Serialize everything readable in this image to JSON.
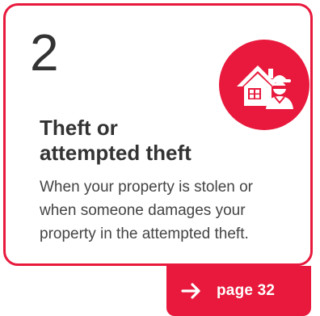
{
  "card": {
    "number": "2",
    "title_lines": [
      "Theft or",
      "attempted theft"
    ],
    "description_lines": [
      "When your property is stolen or",
      "when someone damages your",
      "property in the attempted theft."
    ],
    "icon": "house-burglar-icon"
  },
  "link": {
    "icon": "arrow-right-icon",
    "label": "page 32"
  },
  "colors": {
    "accent": "#e8193c",
    "text": "#333333"
  }
}
